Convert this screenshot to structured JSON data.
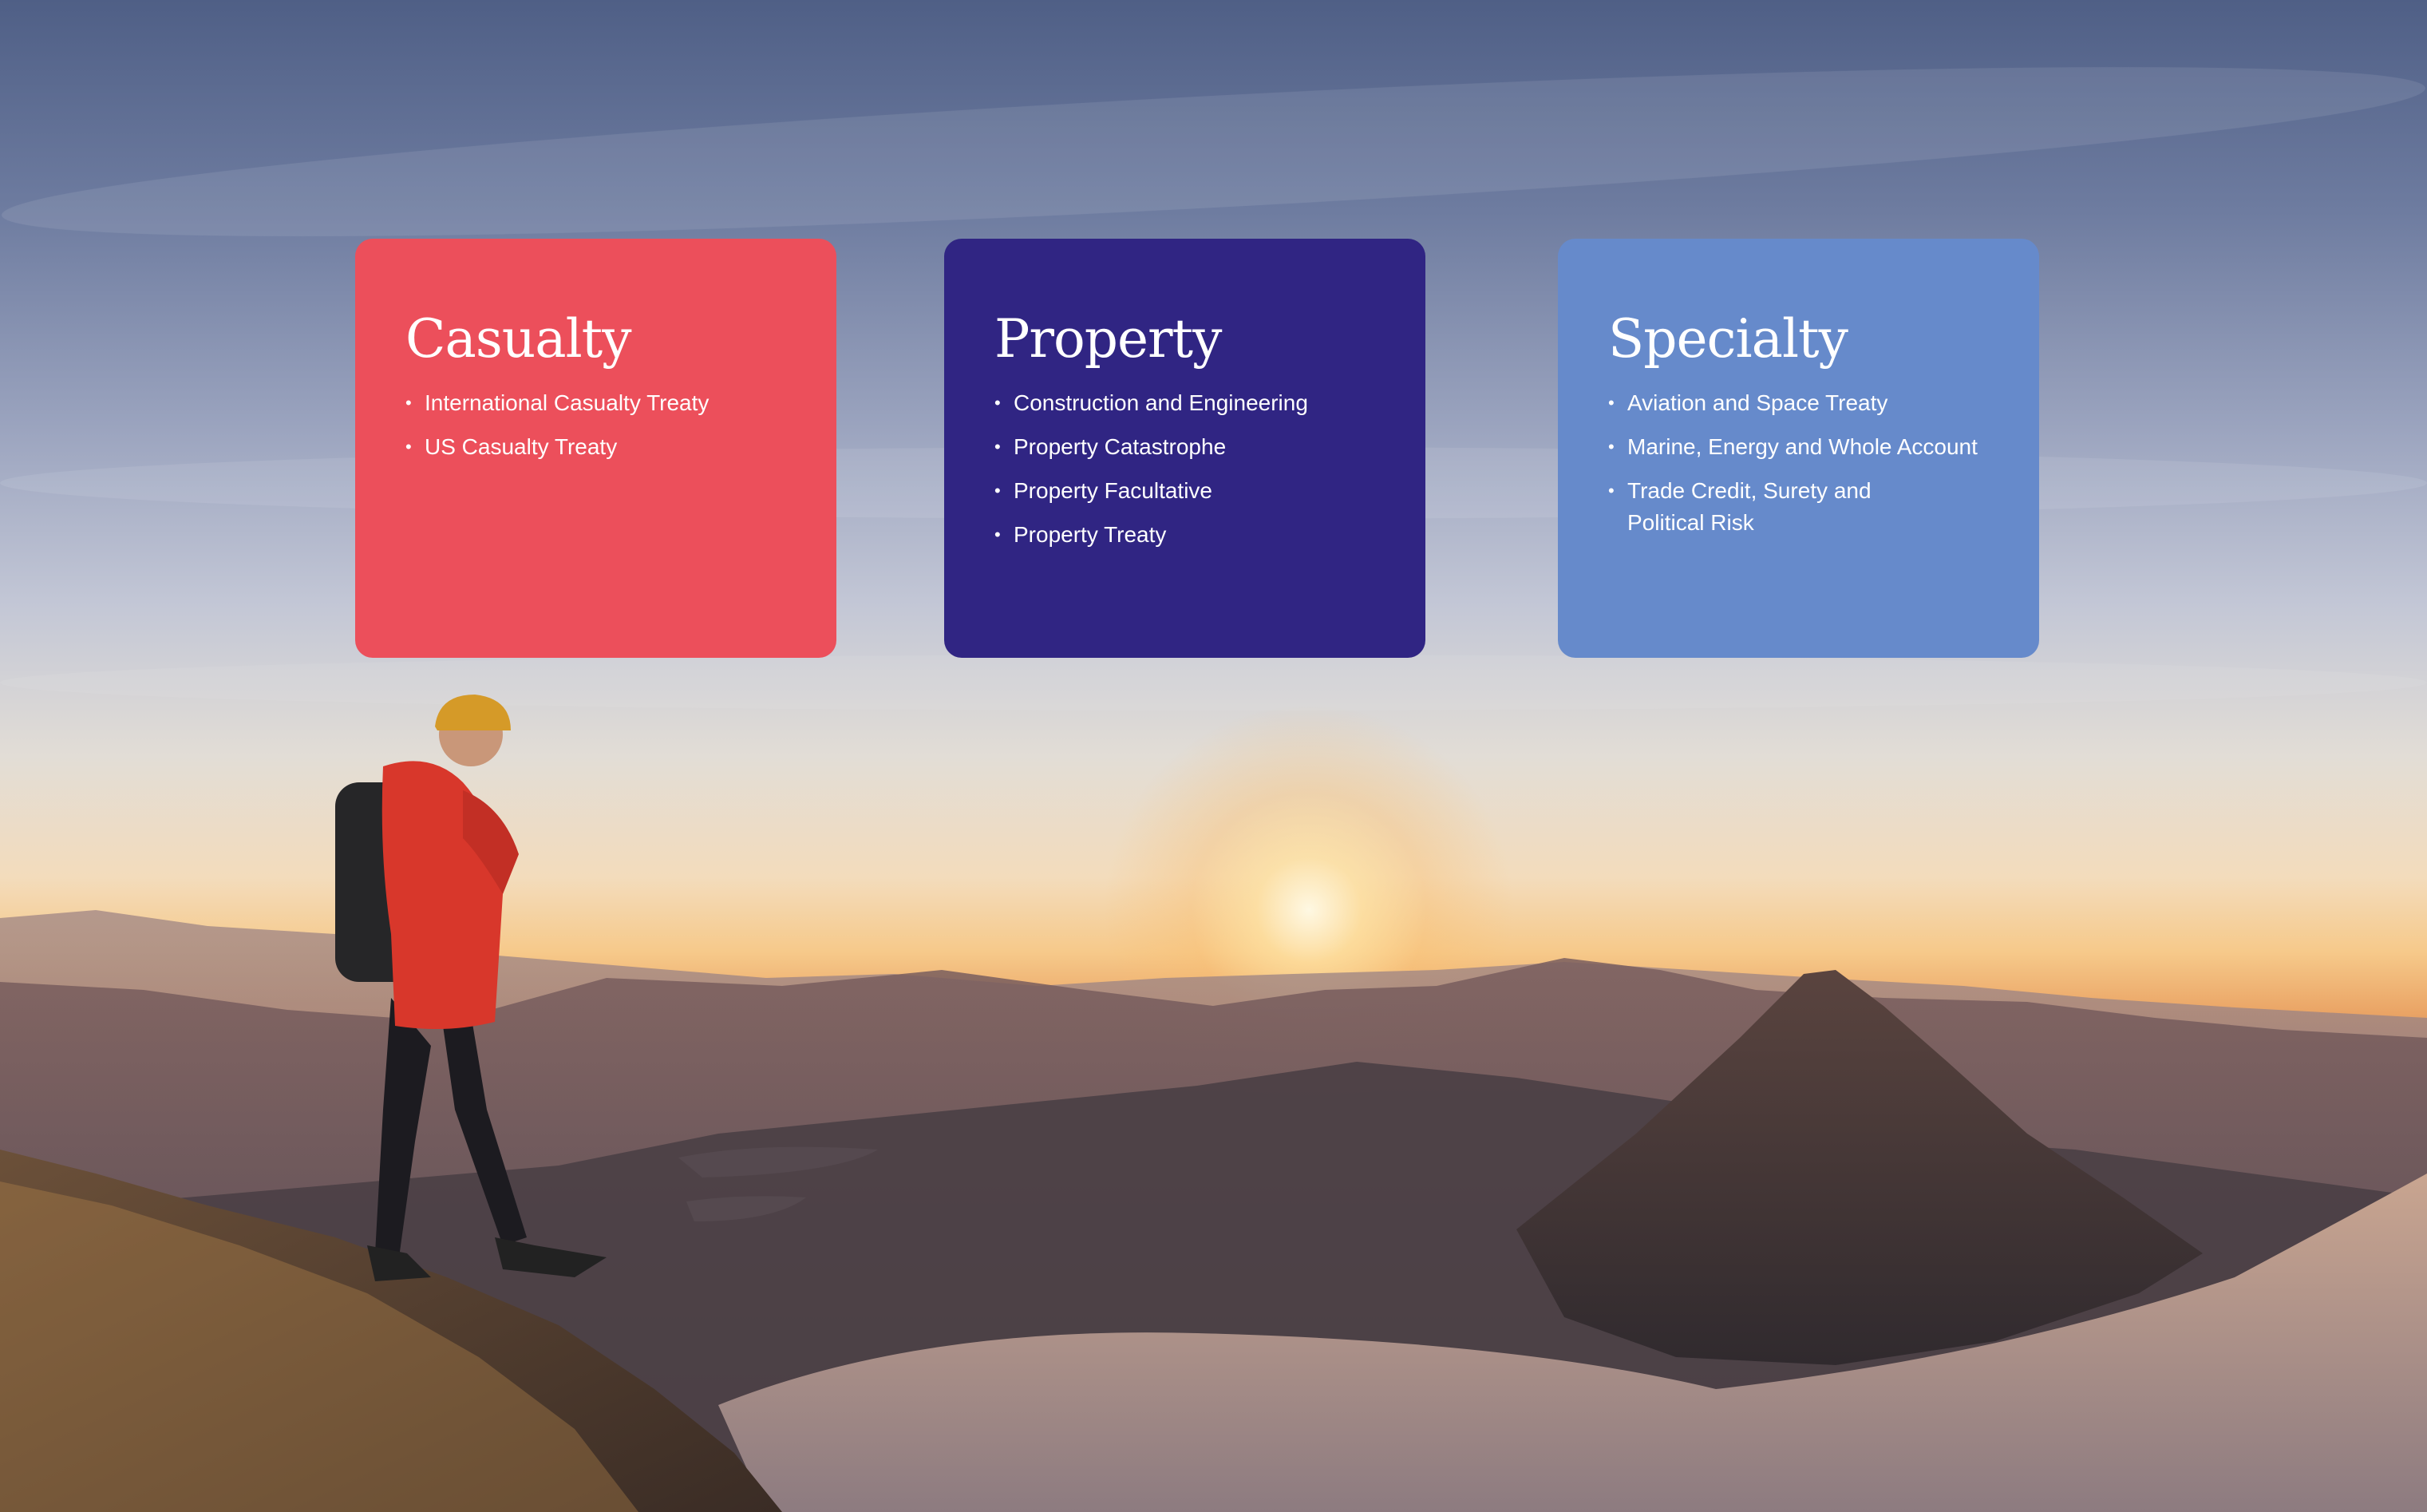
{
  "background": {
    "description_icon": "mountain-sunset-hiker-photo"
  },
  "cards": [
    {
      "title": "Casualty",
      "color": "#ec4f5b",
      "items": [
        "International Casualty Treaty",
        "US Casualty Treaty"
      ]
    },
    {
      "title": "Property",
      "color": "#302583",
      "items": [
        "Construction and Engineering",
        "Property Catastrophe",
        "Property Facultative",
        "Property Treaty"
      ]
    },
    {
      "title": "Specialty",
      "color": "#668acb",
      "items": [
        "Aviation and Space Treaty",
        "Marine, Energy and Whole Account",
        "Trade Credit, Surety and Political Risk"
      ]
    }
  ],
  "bullet_glyph": "•"
}
